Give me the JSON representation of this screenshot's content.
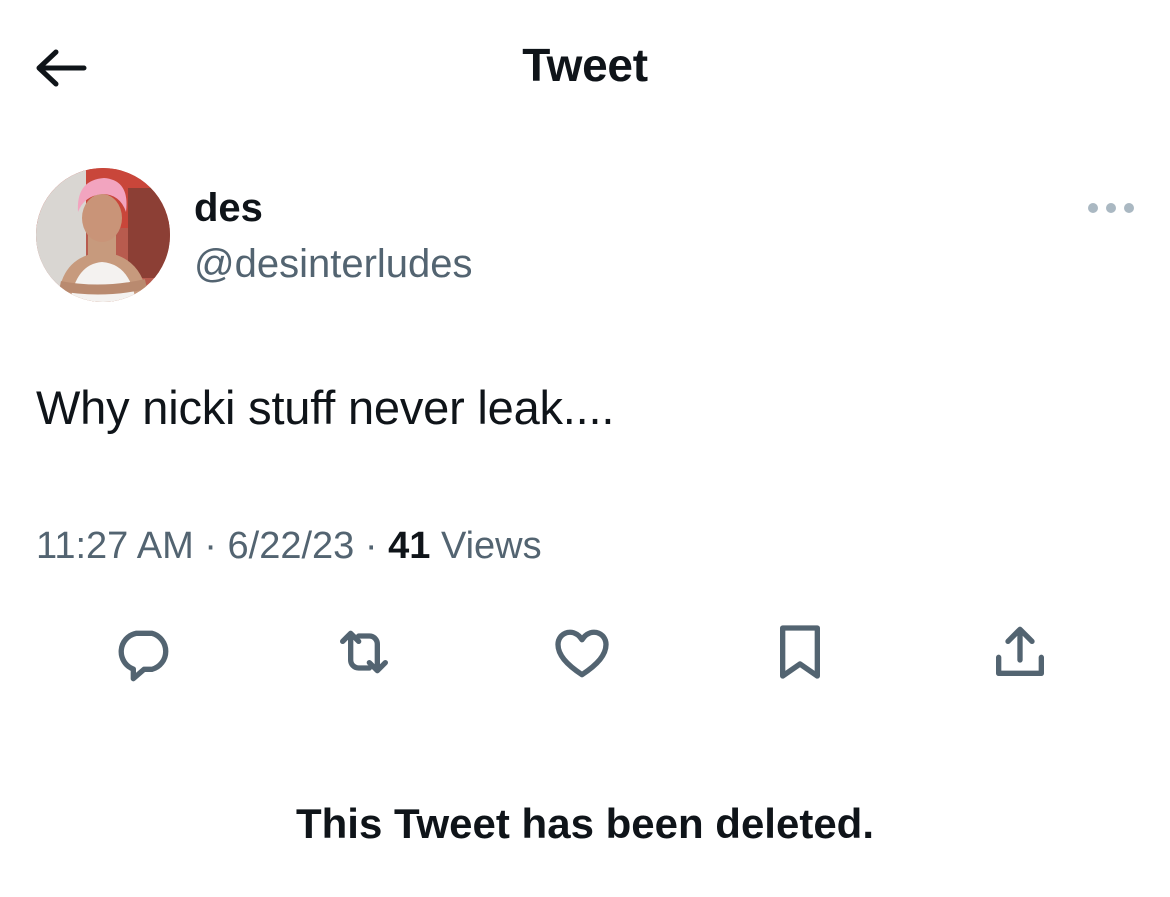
{
  "header": {
    "back_icon": "arrow-left-icon",
    "title": "Tweet"
  },
  "author": {
    "display_name": "des",
    "handle": "@desinterludes",
    "more_icon": "more-horizontal-icon"
  },
  "tweet": {
    "text": "Why nicki stuff never leak....",
    "time": "11:27 AM",
    "date": "6/22/23",
    "separator": "·",
    "views_count": "41",
    "views_label": "Views"
  },
  "actions": [
    {
      "icon": "reply-icon"
    },
    {
      "icon": "retweet-icon"
    },
    {
      "icon": "like-icon"
    },
    {
      "icon": "bookmark-icon"
    },
    {
      "icon": "share-icon"
    }
  ],
  "status": {
    "deleted_message": "This Tweet has been deleted."
  },
  "colors": {
    "text_primary": "#0f1419",
    "text_secondary": "#536471",
    "icon_gray": "#536471",
    "background": "#ffffff"
  }
}
